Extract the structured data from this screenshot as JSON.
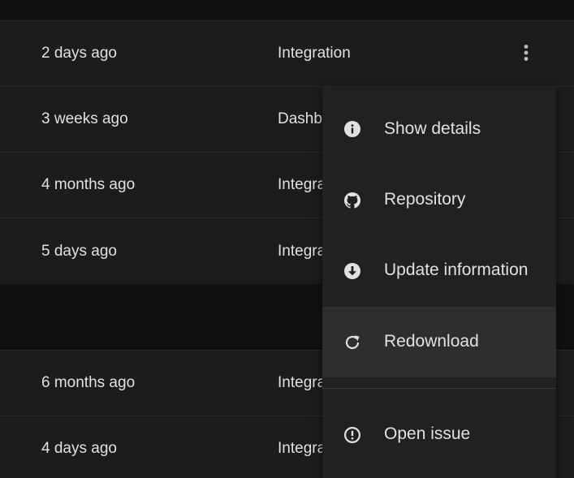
{
  "rows": [
    {
      "updated": "2 days ago",
      "category": "Integration"
    },
    {
      "updated": "3 weeks ago",
      "category": "Dashbo"
    },
    {
      "updated": "4 months ago",
      "category": "Integra"
    },
    {
      "updated": "5 days ago",
      "category": "Integra"
    },
    {
      "updated": "6 months ago",
      "category": "Integra"
    },
    {
      "updated": "4 days ago",
      "category": "Integra"
    }
  ],
  "overflow_menu": {
    "trigger_icon": "more-vertical-icon",
    "items": [
      {
        "label": "Show details",
        "icon": "info-icon"
      },
      {
        "label": "Repository",
        "icon": "github-icon"
      },
      {
        "label": "Update information",
        "icon": "download-circle-icon"
      },
      {
        "label": "Redownload",
        "icon": "refresh-icon",
        "highlighted": true
      },
      {
        "label": "Open issue",
        "icon": "alert-circle-icon"
      }
    ]
  },
  "colors": {
    "background": "#111111",
    "row": "#1c1c1c",
    "menu": "#212121",
    "menu_highlight": "#2e2e2e",
    "text": "#e1e1e1",
    "icon": "#e1e1e1"
  }
}
